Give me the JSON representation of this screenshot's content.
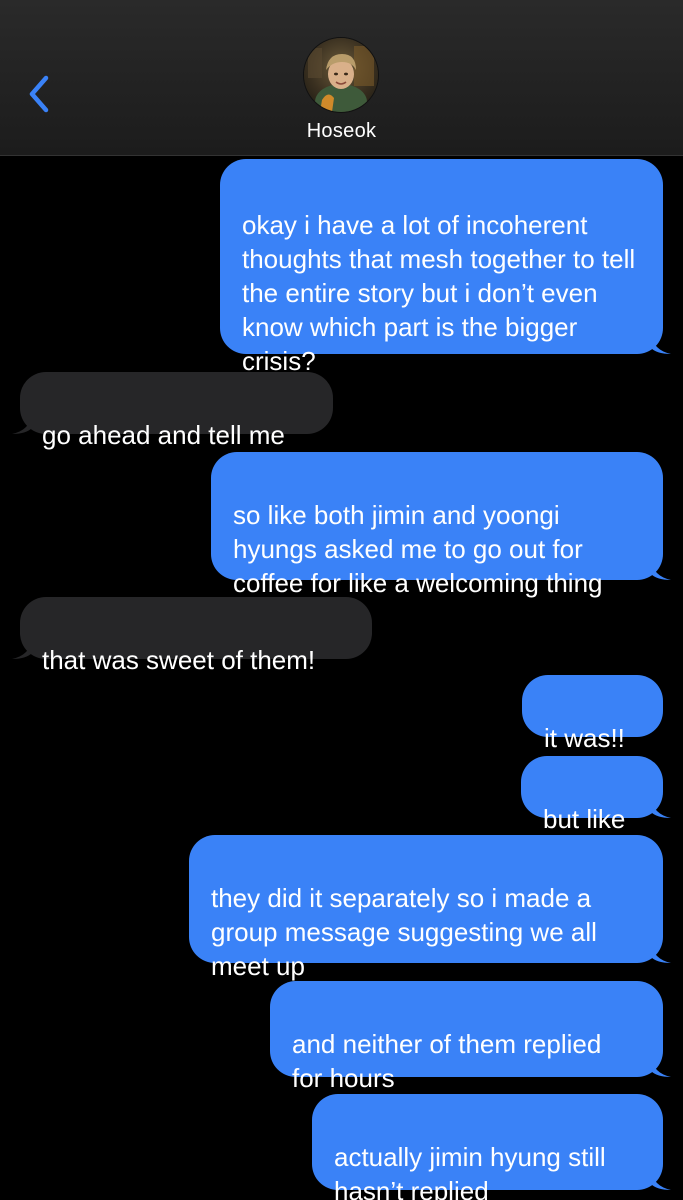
{
  "header": {
    "contact_name": "Hoseok",
    "back_icon": "chevron-left-icon",
    "accent_color": "#3a82f7"
  },
  "messages": [
    {
      "from": "me",
      "text": "okay i have a lot of incoherent\nthoughts that mesh together to tell\nthe entire story but i don’t even\nknow which part is the bigger\ncrisis?"
    },
    {
      "from": "them",
      "text": "go ahead and tell me"
    },
    {
      "from": "me",
      "text": "so like both jimin and yoongi\nhyungs asked me to go out for\ncoffee for like a welcoming thing"
    },
    {
      "from": "them",
      "text": "that was sweet of them!"
    },
    {
      "from": "me",
      "text": "it was!!"
    },
    {
      "from": "me",
      "text": "but like"
    },
    {
      "from": "me",
      "text": "they did it separately so i made a\ngroup message suggesting we all\nmeet up"
    },
    {
      "from": "me",
      "text": "and neither of them replied\nfor hours"
    },
    {
      "from": "me",
      "text": "actually jimin hyung still\nhasn’t replied"
    }
  ],
  "colors": {
    "sent_bubble": "#3a82f7",
    "received_bubble": "#262628",
    "background": "#000000"
  }
}
